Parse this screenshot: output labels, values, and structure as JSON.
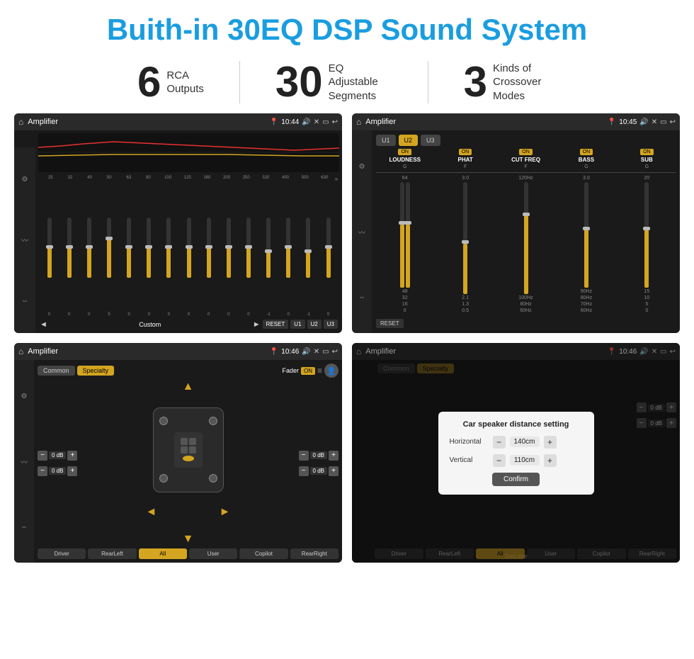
{
  "header": {
    "title": "Buith-in 30EQ DSP Sound System"
  },
  "stats": [
    {
      "number": "6",
      "label": "RCA\nOutputs"
    },
    {
      "number": "30",
      "label": "EQ Adjustable\nSegments"
    },
    {
      "number": "3",
      "label": "Kinds of\nCrossover Modes"
    }
  ],
  "screens": [
    {
      "id": "eq-screen",
      "bar": {
        "time": "10:44",
        "title": "Amplifier"
      },
      "type": "eq"
    },
    {
      "id": "amp-screen",
      "bar": {
        "time": "10:45",
        "title": "Amplifier"
      },
      "type": "amp"
    },
    {
      "id": "speaker-screen",
      "bar": {
        "time": "10:46",
        "title": "Amplifier"
      },
      "type": "speaker"
    },
    {
      "id": "dialog-screen",
      "bar": {
        "time": "10:46",
        "title": "Amplifier"
      },
      "type": "dialog"
    }
  ],
  "eq": {
    "freqs": [
      "25",
      "32",
      "40",
      "50",
      "63",
      "80",
      "100",
      "125",
      "160",
      "200",
      "250",
      "320",
      "400",
      "500",
      "630"
    ],
    "values": [
      "0",
      "0",
      "0",
      "5",
      "0",
      "0",
      "0",
      "0",
      "0",
      "0",
      "0",
      "-1",
      "0",
      "-1"
    ],
    "controls": {
      "prev": "◄",
      "label": "Custom",
      "next": "►",
      "reset": "RESET",
      "u1": "U1",
      "u2": "U2",
      "u3": "U3"
    }
  },
  "amp": {
    "presets": [
      "U1",
      "U2",
      "U3"
    ],
    "channels": [
      {
        "name": "LOUDNESS",
        "state": "ON"
      },
      {
        "name": "PHAT",
        "state": "ON"
      },
      {
        "name": "CUT FREQ",
        "state": "ON"
      },
      {
        "name": "BASS",
        "state": "ON"
      },
      {
        "name": "SUB",
        "state": "ON"
      }
    ],
    "reset": "RESET"
  },
  "speaker": {
    "tabs": [
      "Common",
      "Specialty"
    ],
    "fader_label": "Fader",
    "fader_state": "ON",
    "positions": [
      {
        "label": "0 dB"
      },
      {
        "label": "0 dB"
      },
      {
        "label": "0 dB"
      },
      {
        "label": "0 dB"
      }
    ],
    "buttons": [
      "Driver",
      "RearLeft",
      "All",
      "User",
      "Copilot",
      "RearRight"
    ]
  },
  "dialog": {
    "title": "Car speaker distance setting",
    "rows": [
      {
        "label": "Horizontal",
        "value": "140cm"
      },
      {
        "label": "Vertical",
        "value": "110cm"
      }
    ],
    "confirm": "Confirm",
    "side_values": [
      "0 dB",
      "0 dB"
    ]
  },
  "watermark": "Seicane"
}
